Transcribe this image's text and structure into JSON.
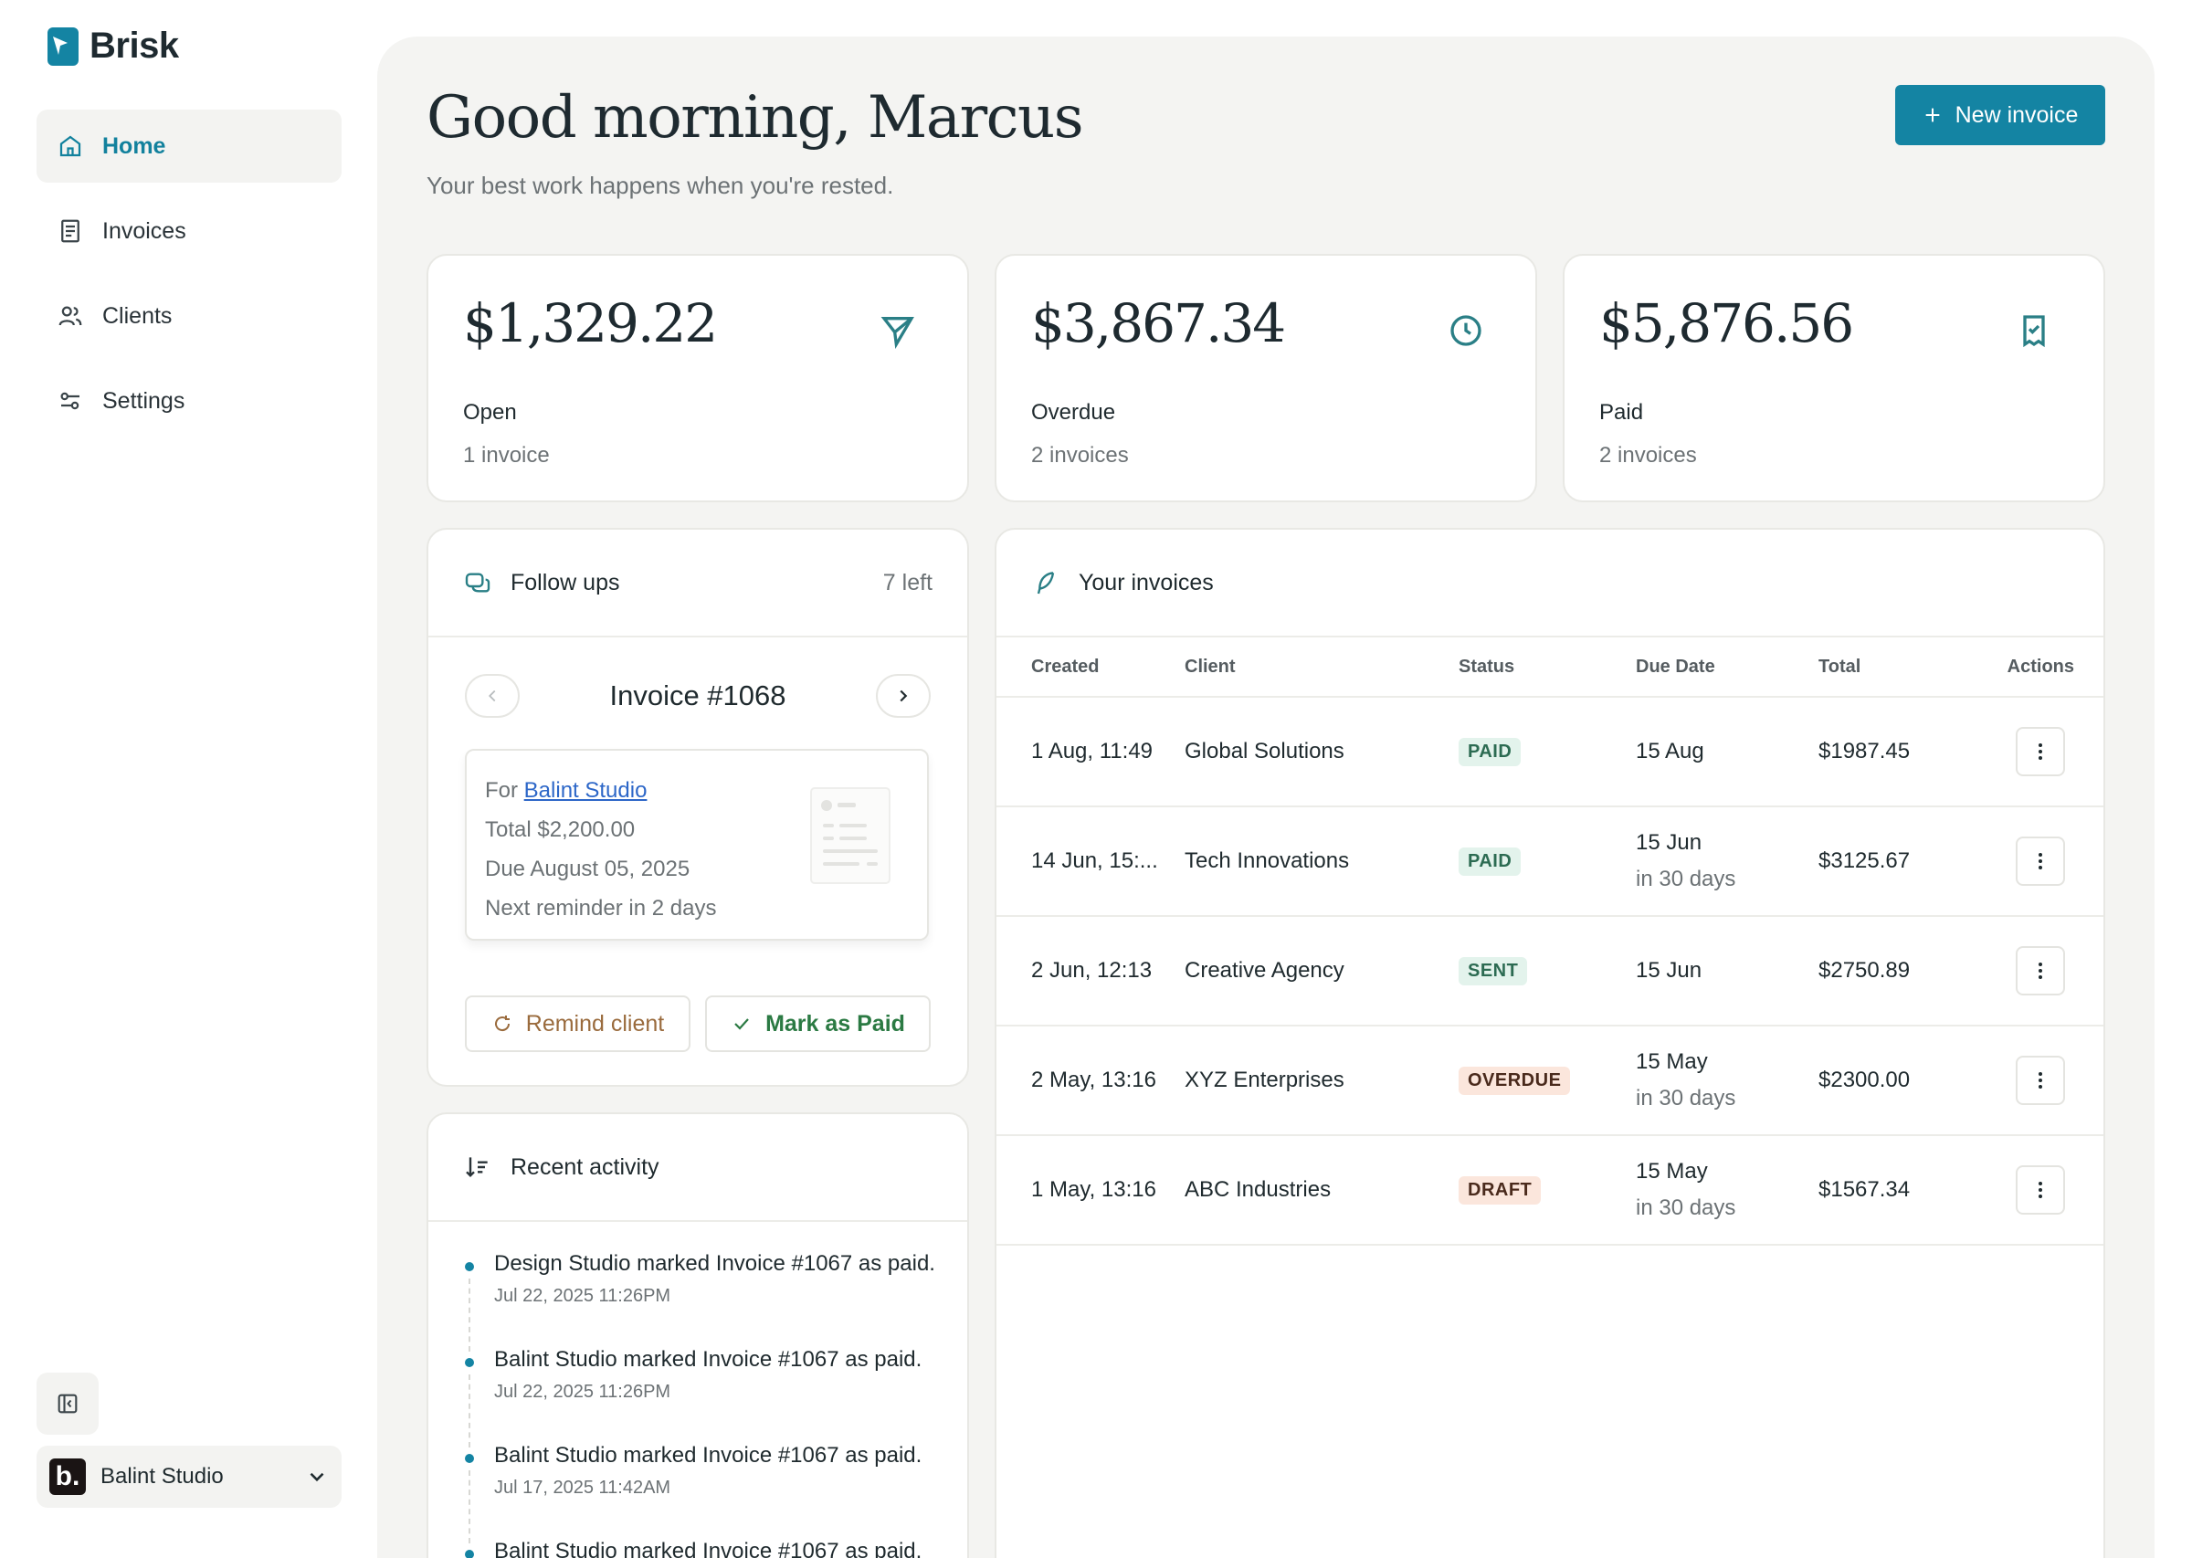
{
  "app": {
    "name": "Brisk",
    "accent": "#1484a3"
  },
  "sidebar": {
    "items": [
      {
        "label": "Home",
        "icon": "home-icon",
        "active": true
      },
      {
        "label": "Invoices",
        "icon": "invoice-icon",
        "active": false
      },
      {
        "label": "Clients",
        "icon": "users-icon",
        "active": false
      },
      {
        "label": "Settings",
        "icon": "sliders-icon",
        "active": false
      }
    ],
    "workspace": {
      "avatar_letter": "b.",
      "name": "Balint Studio"
    }
  },
  "header": {
    "greeting": "Good morning, Marcus",
    "subtitle": "Your best work happens when you're rested.",
    "new_invoice_label": "New invoice"
  },
  "stats": [
    {
      "amount": "$1,329.22",
      "label": "Open",
      "sub": "1 invoice",
      "icon": "send-icon"
    },
    {
      "amount": "$3,867.34",
      "label": "Overdue",
      "sub": "2 invoices",
      "icon": "clock-icon"
    },
    {
      "amount": "$5,876.56",
      "label": "Paid",
      "sub": "2 invoices",
      "icon": "receipt-icon"
    }
  ],
  "follow_ups": {
    "title": "Follow ups",
    "remaining": "7 left",
    "invoice_title": "Invoice #1068",
    "for_prefix": "For",
    "client": "Balint Studio",
    "total": "Total $2,200.00",
    "due": "Due August 05, 2025",
    "reminder": "Next reminder in 2 days",
    "remind_label": "Remind client",
    "paid_label": "Mark as Paid"
  },
  "activity": {
    "title": "Recent activity",
    "items": [
      {
        "text": "Design Studio marked Invoice #1067 as paid.",
        "time": "Jul 22, 2025 11:26PM"
      },
      {
        "text": "Balint Studio marked Invoice #1067 as paid.",
        "time": "Jul 22, 2025 11:26PM"
      },
      {
        "text": "Balint Studio marked Invoice #1067 as paid.",
        "time": "Jul 17, 2025 11:42AM"
      },
      {
        "text": "Balint Studio marked Invoice #1067 as paid.",
        "time": ""
      }
    ]
  },
  "invoices": {
    "title": "Your invoices",
    "columns": [
      "Created",
      "Client",
      "Status",
      "Due Date",
      "Total",
      "Actions"
    ],
    "rows": [
      {
        "created": "1 Aug, 11:49",
        "client": "Global Solutions",
        "status": "PAID",
        "due": "15 Aug",
        "due_sub": "",
        "total": "$1987.45"
      },
      {
        "created": "14 Jun, 15:...",
        "client": "Tech Innovations",
        "status": "PAID",
        "due": "15 Jun",
        "due_sub": "in 30 days",
        "total": "$3125.67"
      },
      {
        "created": "2 Jun, 12:13",
        "client": "Creative Agency",
        "status": "SENT",
        "due": "15 Jun",
        "due_sub": "",
        "total": "$2750.89"
      },
      {
        "created": "2 May, 13:16",
        "client": "XYZ Enterprises",
        "status": "OVERDUE",
        "due": "15 May",
        "due_sub": "in 30 days",
        "total": "$2300.00"
      },
      {
        "created": "1 May, 13:16",
        "client": "ABC Industries",
        "status": "DRAFT",
        "due": "15 May",
        "due_sub": "in 30 days",
        "total": "$1567.34"
      }
    ],
    "status_colors": {
      "PAID": {
        "bg": "#e3f3ec",
        "fg": "#2c6b52"
      },
      "SENT": {
        "bg": "#e3f3ec",
        "fg": "#2c6b52"
      },
      "OVERDUE": {
        "bg": "#fbe6dc",
        "fg": "#4a2a1c"
      },
      "DRAFT": {
        "bg": "#fbe6dc",
        "fg": "#4a2a1c"
      }
    }
  }
}
